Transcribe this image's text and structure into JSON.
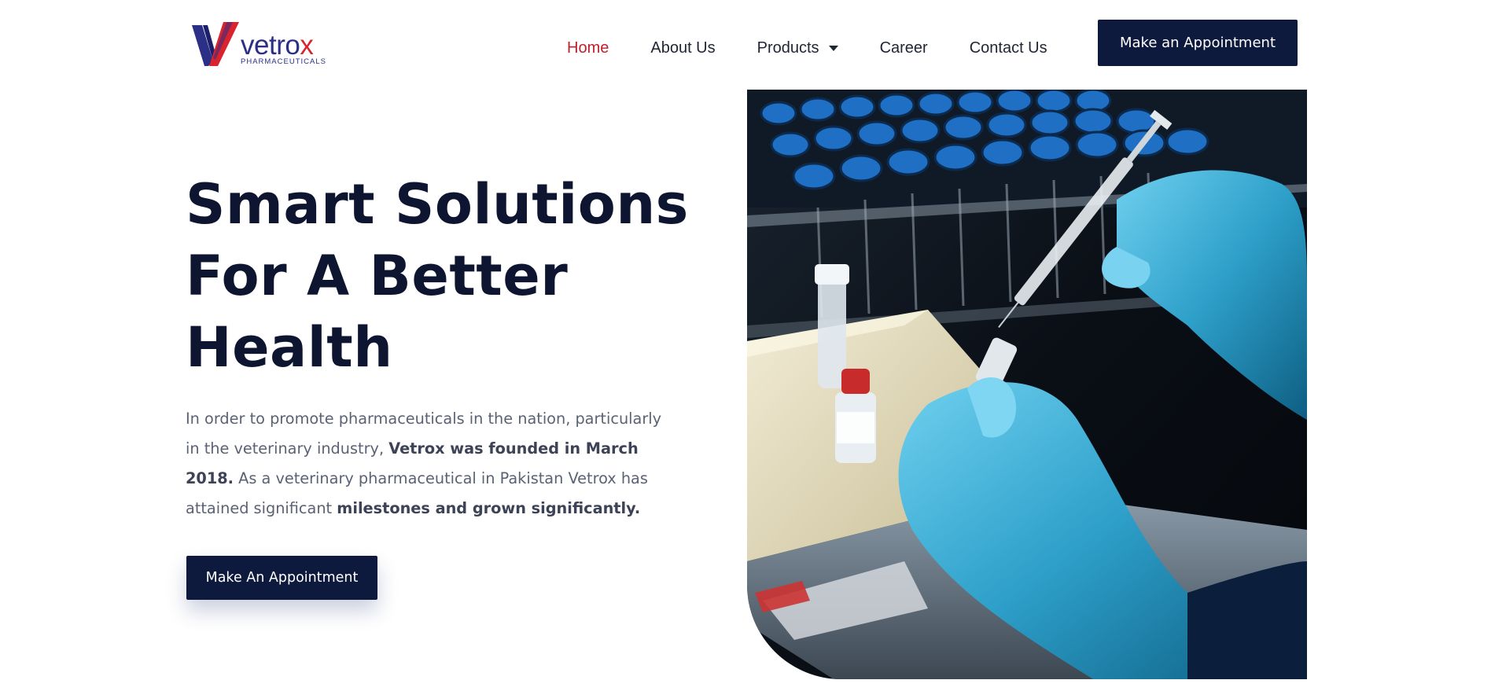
{
  "brand": {
    "name_main": "vetro",
    "name_accent": "x",
    "tagline": "PHARMACEUTICALS",
    "primary_color": "#2b2f86",
    "accent_color": "#d9232e"
  },
  "nav": {
    "items": [
      {
        "label": "Home",
        "active": true
      },
      {
        "label": "About Us",
        "active": false
      },
      {
        "label": "Products",
        "active": false,
        "has_dropdown": true
      },
      {
        "label": "Career",
        "active": false
      },
      {
        "label": "Contact Us",
        "active": false
      }
    ],
    "active_color": "#c0202b",
    "cta_label": "Make an Appointment"
  },
  "hero": {
    "title_lines": [
      "Smart Solutions",
      "For A Better",
      "Health"
    ],
    "paragraph": {
      "part1": "In order to promote pharmaceuticals in the nation, particularly in the veterinary industry, ",
      "bold1": "Vetrox was founded in March 2018.",
      "part2": " As a veterinary pharmaceutical in Pakistan Vetrox has attained significant ",
      "bold2": "milestones and grown significantly."
    },
    "cta_label": "Make An Appointment",
    "button_color": "#0e1a3d"
  },
  "image": {
    "subject": "gloved hands filling a syringe from a vial in a lab"
  }
}
